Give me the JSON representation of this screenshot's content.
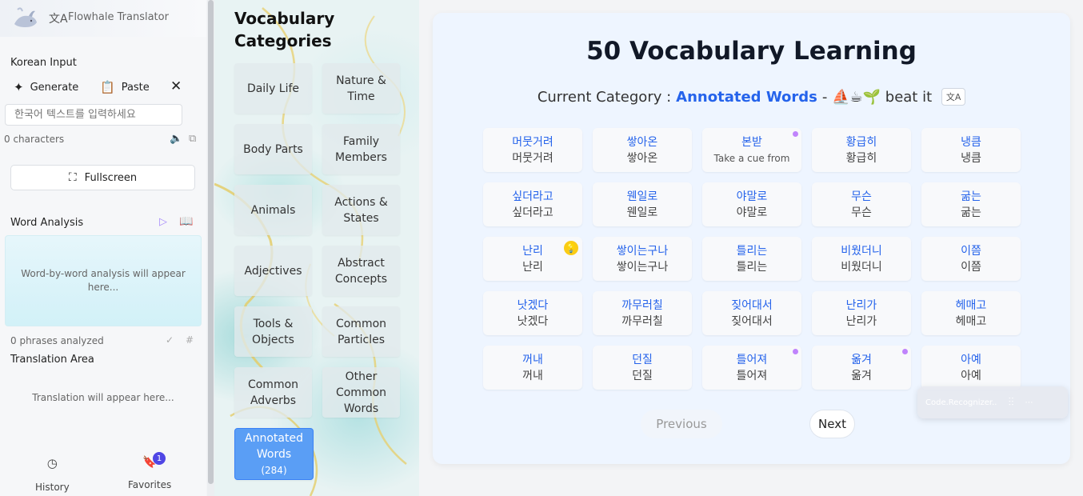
{
  "app": {
    "title": "Flowhale Translator"
  },
  "sidebar": {
    "korean_input_label": "Korean Input",
    "generate_label": "Generate",
    "paste_label": "Paste",
    "input_placeholder": "한국어 텍스트를 입력하세요",
    "char_count": "0 characters",
    "fullscreen_label": "Fullscreen",
    "word_analysis_label": "Word Analysis",
    "analysis_placeholder": "Word-by-word analysis will appear here...",
    "phrases_analyzed": "0 phrases analyzed",
    "translation_area_label": "Translation Area",
    "translation_placeholder": "Translation will appear here...",
    "nav": {
      "history": "History",
      "favorites": "Favorites",
      "favorites_badge": "1"
    }
  },
  "categories": {
    "title": "Vocabulary Categories",
    "items": [
      {
        "label": "Daily Life"
      },
      {
        "label": "Nature & Time"
      },
      {
        "label": "Body Parts"
      },
      {
        "label": "Family Members"
      },
      {
        "label": "Animals"
      },
      {
        "label": "Actions & States"
      },
      {
        "label": "Adjectives"
      },
      {
        "label": "Abstract Concepts"
      },
      {
        "label": "Tools & Objects"
      },
      {
        "label": "Common Particles"
      },
      {
        "label": "Common Adverbs"
      },
      {
        "label": "Other Common Words"
      },
      {
        "label": "Annotated Words",
        "count": "(284)",
        "active": true
      }
    ]
  },
  "main": {
    "title": "50 Vocabulary Learning",
    "current_category_prefix": "Current Category :",
    "current_category": "Annotated Words",
    "current_category_suffix": "- ⛵☕🌱 beat it",
    "translate_icon": "translate-icon",
    "words": [
      {
        "kr": "머뭇거려",
        "tr": "머뭇거려"
      },
      {
        "kr": "쌓아온",
        "tr": "쌓아온"
      },
      {
        "kr": "본받",
        "tr": "Take a cue from",
        "dot": true
      },
      {
        "kr": "황급히",
        "tr": "황급히"
      },
      {
        "kr": "냉큼",
        "tr": "냉큼"
      },
      {
        "kr": "싶더라고",
        "tr": "싶더라고"
      },
      {
        "kr": "웬일로",
        "tr": "웬일로"
      },
      {
        "kr": "야말로",
        "tr": "야말로"
      },
      {
        "kr": "무슨",
        "tr": "무슨"
      },
      {
        "kr": "굶는",
        "tr": "굶는"
      },
      {
        "kr": "난리",
        "tr": "난리",
        "bulb": true
      },
      {
        "kr": "쌓이는구나",
        "tr": "쌓이는구나"
      },
      {
        "kr": "틀리는",
        "tr": "틀리는"
      },
      {
        "kr": "비웠더니",
        "tr": "비웠더니"
      },
      {
        "kr": "이쯤",
        "tr": "이쯤"
      },
      {
        "kr": "낫겠다",
        "tr": "낫겠다"
      },
      {
        "kr": "까무러칠",
        "tr": "까무러칠"
      },
      {
        "kr": "짖어대서",
        "tr": "짖어대서"
      },
      {
        "kr": "난리가",
        "tr": "난리가"
      },
      {
        "kr": "헤매고",
        "tr": "헤매고"
      },
      {
        "kr": "꺼내",
        "tr": "꺼내"
      },
      {
        "kr": "던질",
        "tr": "던질"
      },
      {
        "kr": "틀어져",
        "tr": "틀어져",
        "dot": true
      },
      {
        "kr": "옮겨",
        "tr": "옮겨",
        "dot": true
      },
      {
        "kr": "아예",
        "tr": "아예"
      }
    ],
    "previous_label": "Previous",
    "next_label": "Next"
  },
  "floating_widget": {
    "label": "Code.Recognizer.."
  },
  "colors": {
    "accent": "#2563eb",
    "active_category": "#5a9ef5",
    "dot": "#c084fc",
    "bulb": "#facc15",
    "badge": "#4f46e5"
  }
}
